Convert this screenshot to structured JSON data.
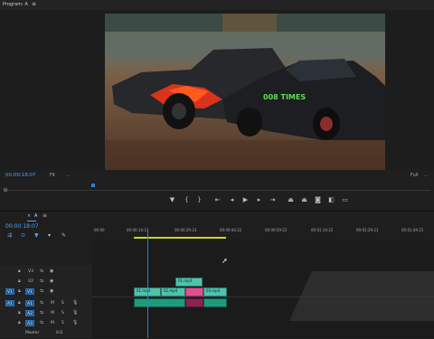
{
  "monitor": {
    "title": "Program: A",
    "menu_glyph": "≡",
    "timecode": "00:00:18:07",
    "fit_label": "Fit",
    "full_label": "Full",
    "playhead_fraction": 0.21
  },
  "transport": {
    "icons": [
      "marker-icon",
      "in-point-icon",
      "out-point-icon",
      "go-to-in-icon",
      "step-back-icon",
      "play-icon",
      "step-forward-icon",
      "go-to-out-icon",
      "lift-icon",
      "extract-icon",
      "camera-icon",
      "compare-icon",
      "safe-margins-icon"
    ]
  },
  "timeline": {
    "tab_close": "×",
    "sequence_name": "A",
    "menu_glyph": "≡",
    "timecode": "00:00:18:07",
    "ruler": [
      "00:00",
      "00:00:14:23",
      "00:00:29:23",
      "00:00:44:22",
      "00:00:59:22",
      "00:01:14:22",
      "00:01:29:21",
      "00:01:44:21"
    ],
    "tracks": [
      {
        "toggle": "",
        "name": "V3"
      },
      {
        "toggle": "",
        "name": "V2"
      },
      {
        "toggle": "V1",
        "name": "V1"
      },
      {
        "toggle": "A1",
        "name": "A1",
        "m": "M",
        "s": "S"
      },
      {
        "toggle": "",
        "name": "A2",
        "m": "M",
        "s": "S"
      },
      {
        "toggle": "",
        "name": "A3",
        "m": "M",
        "s": "S"
      }
    ],
    "master_label": "Master",
    "master_value": "0.0",
    "clips": {
      "v2": "01.mp4",
      "v1a": "01.mp4",
      "v1b": "02.mp4",
      "v1c": "03.mp4"
    }
  },
  "colors": {
    "video_clip": "#4fc3b0",
    "pink_clip": "#e0508f",
    "audio_clip": "#1f9a7a",
    "playhead": "#2f7fd8",
    "work_area": "#c9d820"
  }
}
